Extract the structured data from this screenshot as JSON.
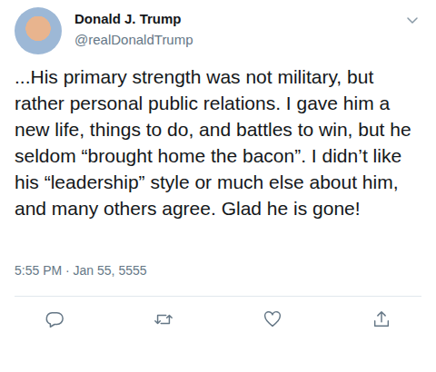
{
  "tweet": {
    "author": {
      "name": "Donald J. Trump",
      "handle": "@realDonaldTrump"
    },
    "text": "...His primary strength was not military, but rather personal public relations. I gave him a new life, things to do, and battles to win, but he seldom “brought home the bacon”. I didn’t like his “leadership” style or much else about him, and many others agree. Glad he is gone!",
    "timestamp": "5:55 PM · Jan 55, 5555"
  },
  "actions": [
    {
      "kind": "reply"
    },
    {
      "kind": "retweet"
    },
    {
      "kind": "like"
    },
    {
      "kind": "share"
    }
  ]
}
